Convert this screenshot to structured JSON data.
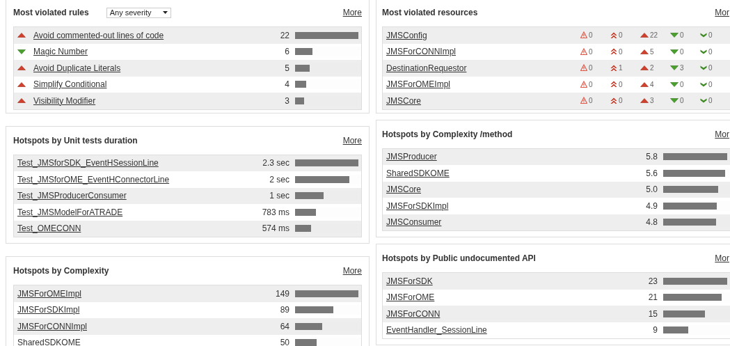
{
  "left_column": [
    {
      "kind": "rules",
      "title": "Most violated rules",
      "filter": {
        "value": "Any severity"
      },
      "more": "More",
      "rows": [
        {
          "kind": "major",
          "name": "Avoid commented-out lines of code",
          "value": "22",
          "level": 1
        },
        {
          "kind": "minor",
          "name": "Magic Number",
          "value": "6",
          "level": 0.27
        },
        {
          "kind": "major",
          "name": "Avoid Duplicate Literals",
          "value": "5",
          "level": 0.23
        },
        {
          "kind": "major",
          "name": "Simplify Conditional",
          "value": "4",
          "level": 0.18
        },
        {
          "kind": "major",
          "name": "Visibility Modifier",
          "value": "3",
          "level": 0.14
        }
      ]
    },
    {
      "kind": "hotspots",
      "title": "Hotspots by Unit tests duration",
      "more": "More",
      "rows": [
        {
          "name": "Test_JMSforSDK_EventHSessionLine",
          "value": "2.3 sec",
          "level": 1
        },
        {
          "name": "Test_JMSforOME_EventHConnectorLine",
          "value": "2 sec",
          "level": 0.86
        },
        {
          "name": "Test_JMSProducerConsumer",
          "value": "1 sec",
          "level": 0.45
        },
        {
          "name": "Test_JMSModelForATRADE",
          "value": "783 ms",
          "level": 0.33
        },
        {
          "name": "Test_OMECONN",
          "value": "574 ms",
          "level": 0.25
        }
      ]
    },
    {
      "kind": "hotspots",
      "title": "Hotspots by Complexity",
      "more": "More",
      "rows": [
        {
          "name": "JMSForOMEImpl",
          "value": "149",
          "level": 1
        },
        {
          "name": "JMSForSDKImpl",
          "value": "89",
          "level": 0.6
        },
        {
          "name": "JMSForCONNImpl",
          "value": "64",
          "level": 0.43
        },
        {
          "name": "SharedSDKOME",
          "value": "50",
          "level": 0.34
        }
      ]
    }
  ],
  "right_column": [
    {
      "kind": "resources",
      "title": "Most violated resources",
      "more": "Mor",
      "rows": [
        {
          "name": "JMSConfig",
          "counts": [
            {
              "kind": "blocker",
              "value": "0"
            },
            {
              "kind": "critical",
              "value": "0"
            },
            {
              "kind": "major",
              "value": "22"
            },
            {
              "kind": "minor",
              "value": "0"
            },
            {
              "kind": "info",
              "value": "0"
            }
          ]
        },
        {
          "name": "JMSForCONNImpl",
          "counts": [
            {
              "kind": "blocker",
              "value": "0"
            },
            {
              "kind": "critical",
              "value": "0"
            },
            {
              "kind": "major",
              "value": "5"
            },
            {
              "kind": "minor",
              "value": "0"
            },
            {
              "kind": "info",
              "value": "0"
            }
          ]
        },
        {
          "name": "DestinationRequestor",
          "counts": [
            {
              "kind": "blocker",
              "value": "0"
            },
            {
              "kind": "critical",
              "value": "1"
            },
            {
              "kind": "major",
              "value": "2"
            },
            {
              "kind": "minor",
              "value": "3"
            },
            {
              "kind": "info",
              "value": "0"
            }
          ]
        },
        {
          "name": "JMSForOMEImpl",
          "counts": [
            {
              "kind": "blocker",
              "value": "0"
            },
            {
              "kind": "critical",
              "value": "0"
            },
            {
              "kind": "major",
              "value": "4"
            },
            {
              "kind": "minor",
              "value": "0"
            },
            {
              "kind": "info",
              "value": "0"
            }
          ]
        },
        {
          "name": "JMSCore",
          "counts": [
            {
              "kind": "blocker",
              "value": "0"
            },
            {
              "kind": "critical",
              "value": "0"
            },
            {
              "kind": "major",
              "value": "3"
            },
            {
              "kind": "minor",
              "value": "0"
            },
            {
              "kind": "info",
              "value": "0"
            }
          ]
        }
      ]
    },
    {
      "kind": "hotspots",
      "title": "Hotspots by Complexity /method",
      "more": "Mor",
      "rows": [
        {
          "name": "JMSProducer",
          "value": "5.8",
          "level": 1
        },
        {
          "name": "SharedSDKOME",
          "value": "5.6",
          "level": 0.97
        },
        {
          "name": "JMSCore",
          "value": "5.0",
          "level": 0.86
        },
        {
          "name": "JMSForSDKImpl",
          "value": "4.9",
          "level": 0.84
        },
        {
          "name": "JMSConsumer",
          "value": "4.8",
          "level": 0.83
        }
      ]
    },
    {
      "kind": "hotspots",
      "title": "Hotspots by Public undocumented API",
      "more": "Mor",
      "rows": [
        {
          "name": "JMSForSDK",
          "value": "23",
          "level": 1
        },
        {
          "name": "JMSForOME",
          "value": "21",
          "level": 0.91
        },
        {
          "name": "JMSForCONN",
          "value": "15",
          "level": 0.65
        },
        {
          "name": "EventHandler_SessionLine",
          "value": "9",
          "level": 0.39
        }
      ]
    }
  ]
}
